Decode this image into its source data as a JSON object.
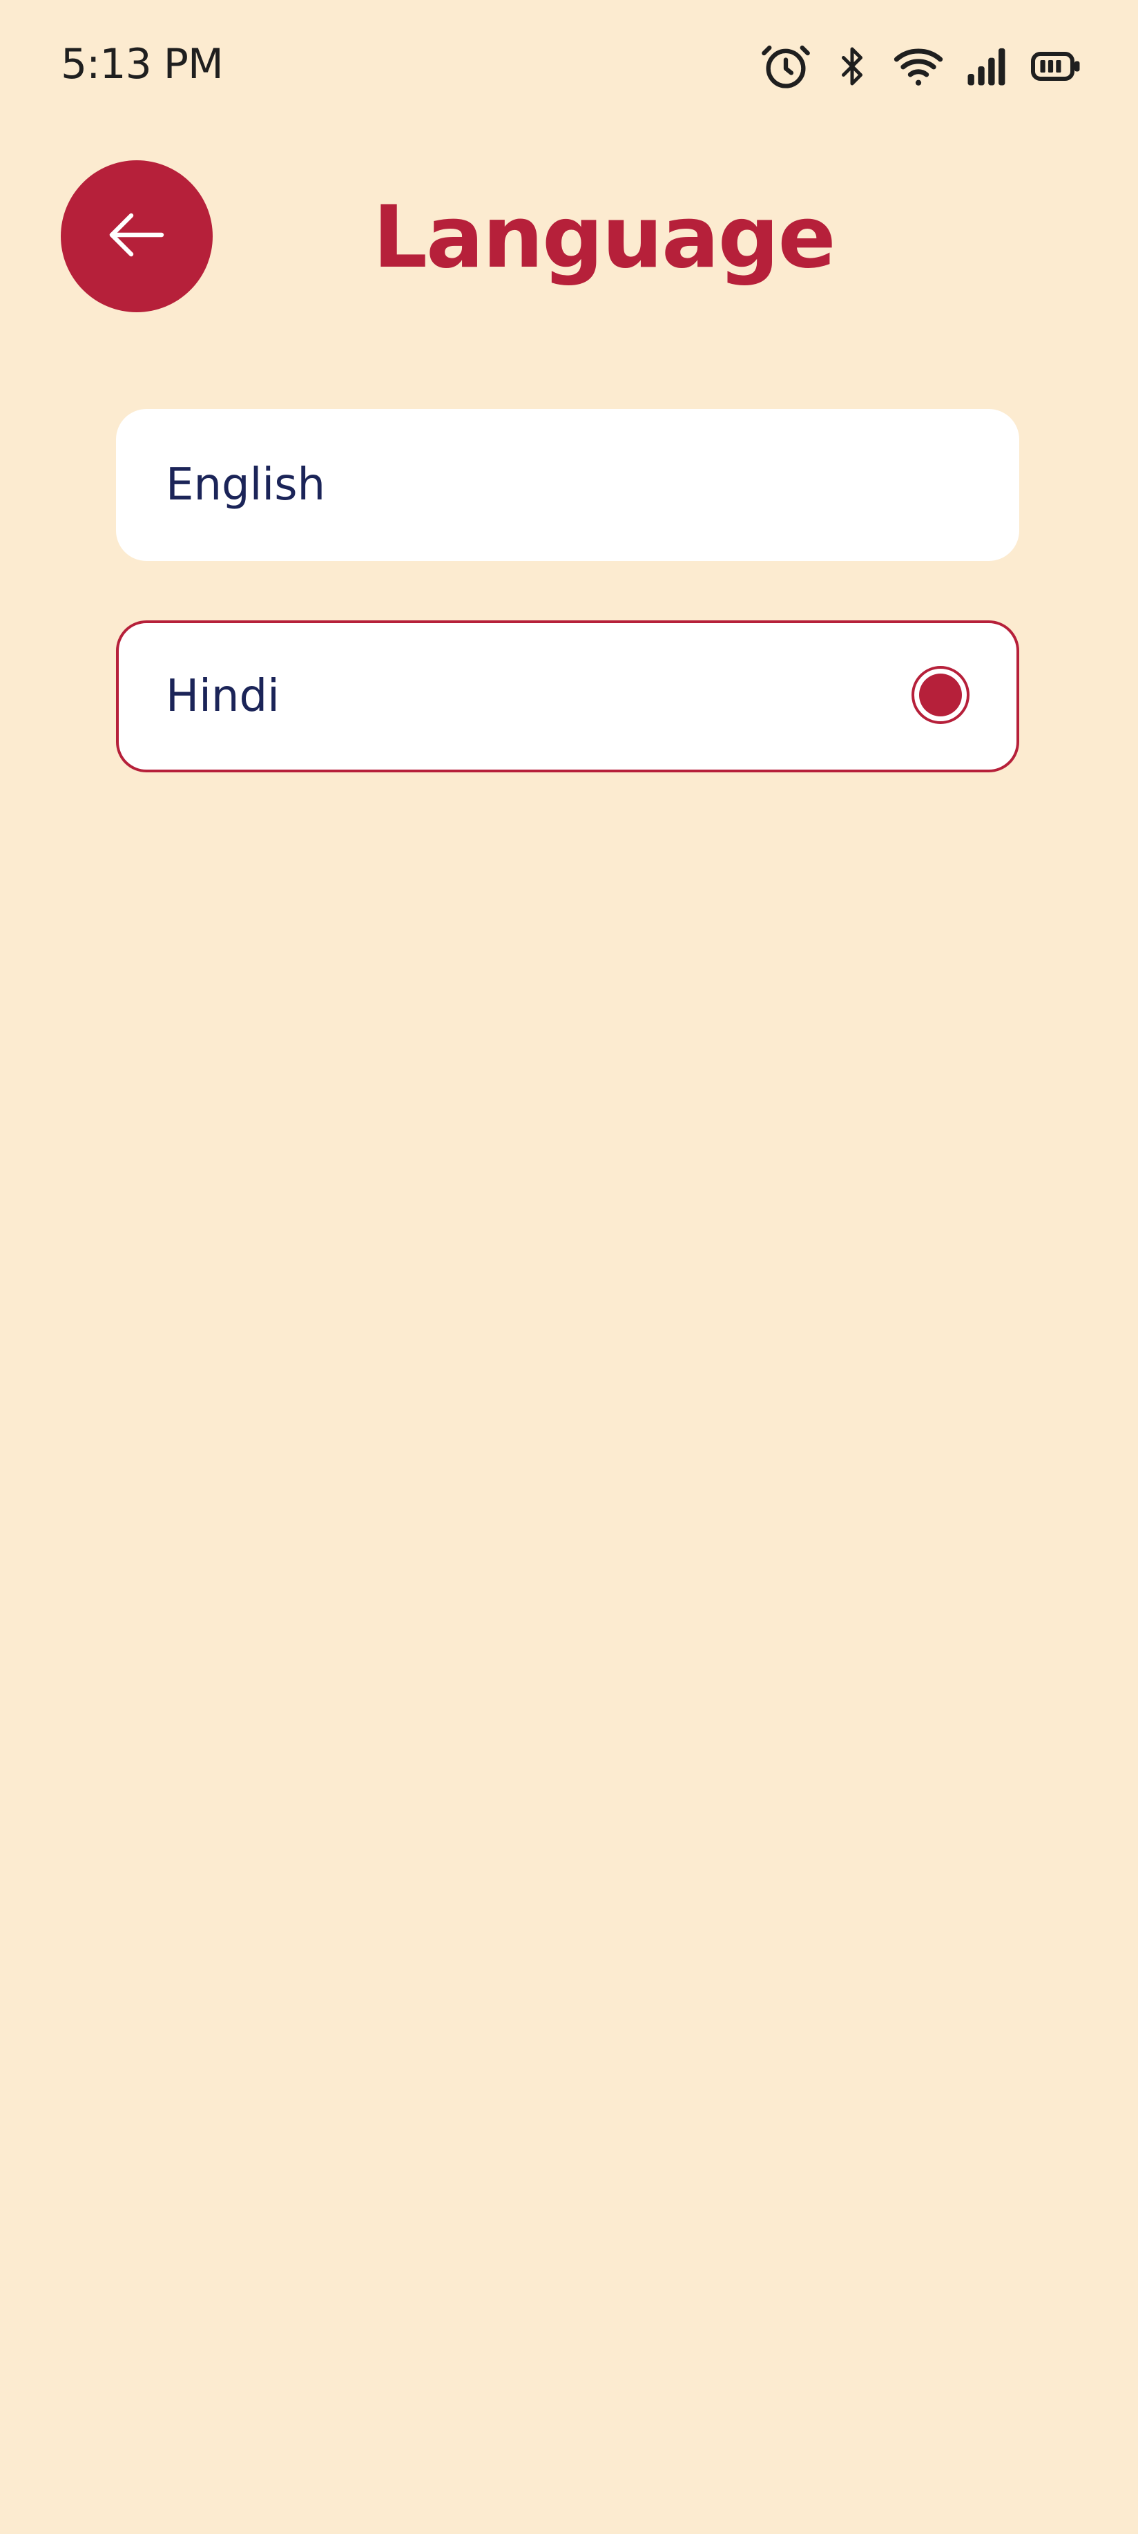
{
  "status_bar": {
    "time": "5:13 PM",
    "icons": [
      "alarm-icon",
      "bluetooth-icon",
      "wifi-icon",
      "signal-icon",
      "battery-icon"
    ]
  },
  "header": {
    "back_icon": "arrow-left-icon",
    "title": "Language"
  },
  "languages": [
    {
      "label": "English",
      "selected": false
    },
    {
      "label": "Hindi",
      "selected": true
    }
  ],
  "colors": {
    "background": "#FCEBD0",
    "accent": "#B6203A",
    "option_text": "#1B2458",
    "card": "#FFFFFF"
  }
}
